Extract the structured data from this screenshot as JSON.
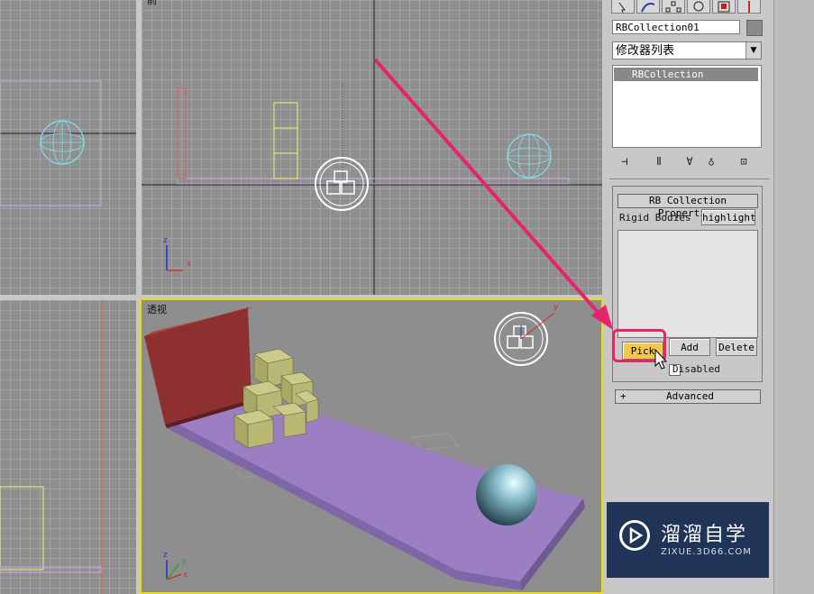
{
  "viewports": {
    "front_label": "前",
    "perspective_label": "透视",
    "axis_x": "x",
    "axis_y": "y",
    "axis_z": "z"
  },
  "command_panel": {
    "tabs": [
      "create-tab",
      "modify-tab",
      "hierarchy-tab",
      "motion-tab",
      "display-tab",
      "utilities-tab"
    ],
    "object_name": "RBCollection01",
    "modifier_list_label": "修改器列表",
    "modifier_stack": [
      "RBCollection"
    ],
    "stack_tools": [
      "pin-stack-icon",
      "show-end-result-icon",
      "make-unique-icon",
      "remove-modifier-icon",
      "configure-modifier-sets-icon"
    ]
  },
  "rollout": {
    "title": "RB Collection Properties",
    "rigid_bodies_label": "Rigid Bodies",
    "highlight_button": "highlight",
    "pick_button": "Pick",
    "add_button": "Add",
    "delete_button": "Delete",
    "disabled_label": "Disabled",
    "disabled_checked": false
  },
  "advanced_rollout": {
    "toggle": "+",
    "title": "Advanced"
  },
  "watermark": {
    "title": "溜溜自学",
    "subtitle": "ZIXUE.3D66.COM"
  },
  "colors": {
    "viewport_bg": "#8f8f8f",
    "active_viewport_border": "#e8e000",
    "highlight_arrow": "#e6246e",
    "pick_button": "#f4c64c",
    "floor": "#9b7fc2",
    "wall": "#8e3030",
    "boxes": "#b3b273",
    "sphere": "#8fc3d0"
  }
}
